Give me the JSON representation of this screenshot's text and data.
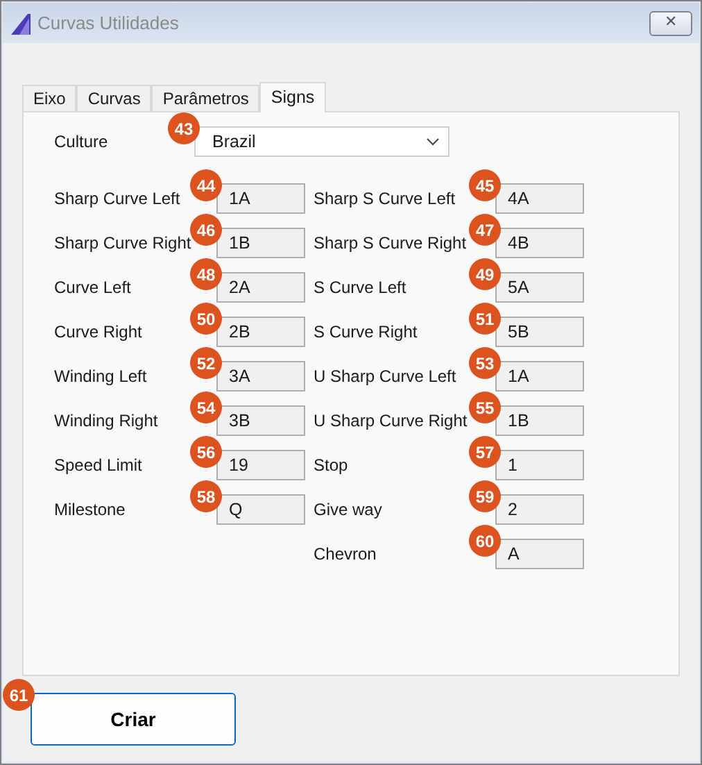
{
  "window": {
    "title": "Curvas Utilidades",
    "close": "✕"
  },
  "tabs": [
    {
      "label": "Eixo",
      "selected": false
    },
    {
      "label": "Curvas",
      "selected": false
    },
    {
      "label": "Parâmetros",
      "selected": false
    },
    {
      "label": "Signs",
      "selected": true
    }
  ],
  "culture": {
    "label": "Culture",
    "value": "Brazil",
    "badge": "43"
  },
  "rows": [
    {
      "left": {
        "label": "Sharp Curve Left",
        "value": "1A",
        "badge": "44"
      },
      "right": {
        "label": "Sharp S Curve Left",
        "value": "4A",
        "badge": "45"
      }
    },
    {
      "left": {
        "label": "Sharp Curve Right",
        "value": "1B",
        "badge": "46"
      },
      "right": {
        "label": "Sharp S Curve Right",
        "value": "4B",
        "badge": "47"
      }
    },
    {
      "left": {
        "label": "Curve Left",
        "value": "2A",
        "badge": "48"
      },
      "right": {
        "label": "S Curve Left",
        "value": "5A",
        "badge": "49"
      }
    },
    {
      "left": {
        "label": "Curve Right",
        "value": "2B",
        "badge": "50"
      },
      "right": {
        "label": "S Curve Right",
        "value": "5B",
        "badge": "51"
      }
    },
    {
      "left": {
        "label": "Winding Left",
        "value": "3A",
        "badge": "52"
      },
      "right": {
        "label": "U Sharp Curve Left",
        "value": "1A",
        "badge": "53"
      }
    },
    {
      "left": {
        "label": "Winding Right",
        "value": "3B",
        "badge": "54"
      },
      "right": {
        "label": "U Sharp Curve Right",
        "value": "1B",
        "badge": "55"
      }
    },
    {
      "left": {
        "label": "Speed Limit",
        "value": "19",
        "badge": "56"
      },
      "right": {
        "label": "Stop",
        "value": "1",
        "badge": "57"
      }
    },
    {
      "left": {
        "label": "Milestone",
        "value": "Q",
        "badge": "58"
      },
      "right": {
        "label": "Give way",
        "value": "2",
        "badge": "59"
      }
    },
    {
      "right": {
        "label": "Chevron",
        "value": "A",
        "badge": "60"
      }
    }
  ],
  "button": {
    "label": "Criar",
    "badge": "61"
  }
}
